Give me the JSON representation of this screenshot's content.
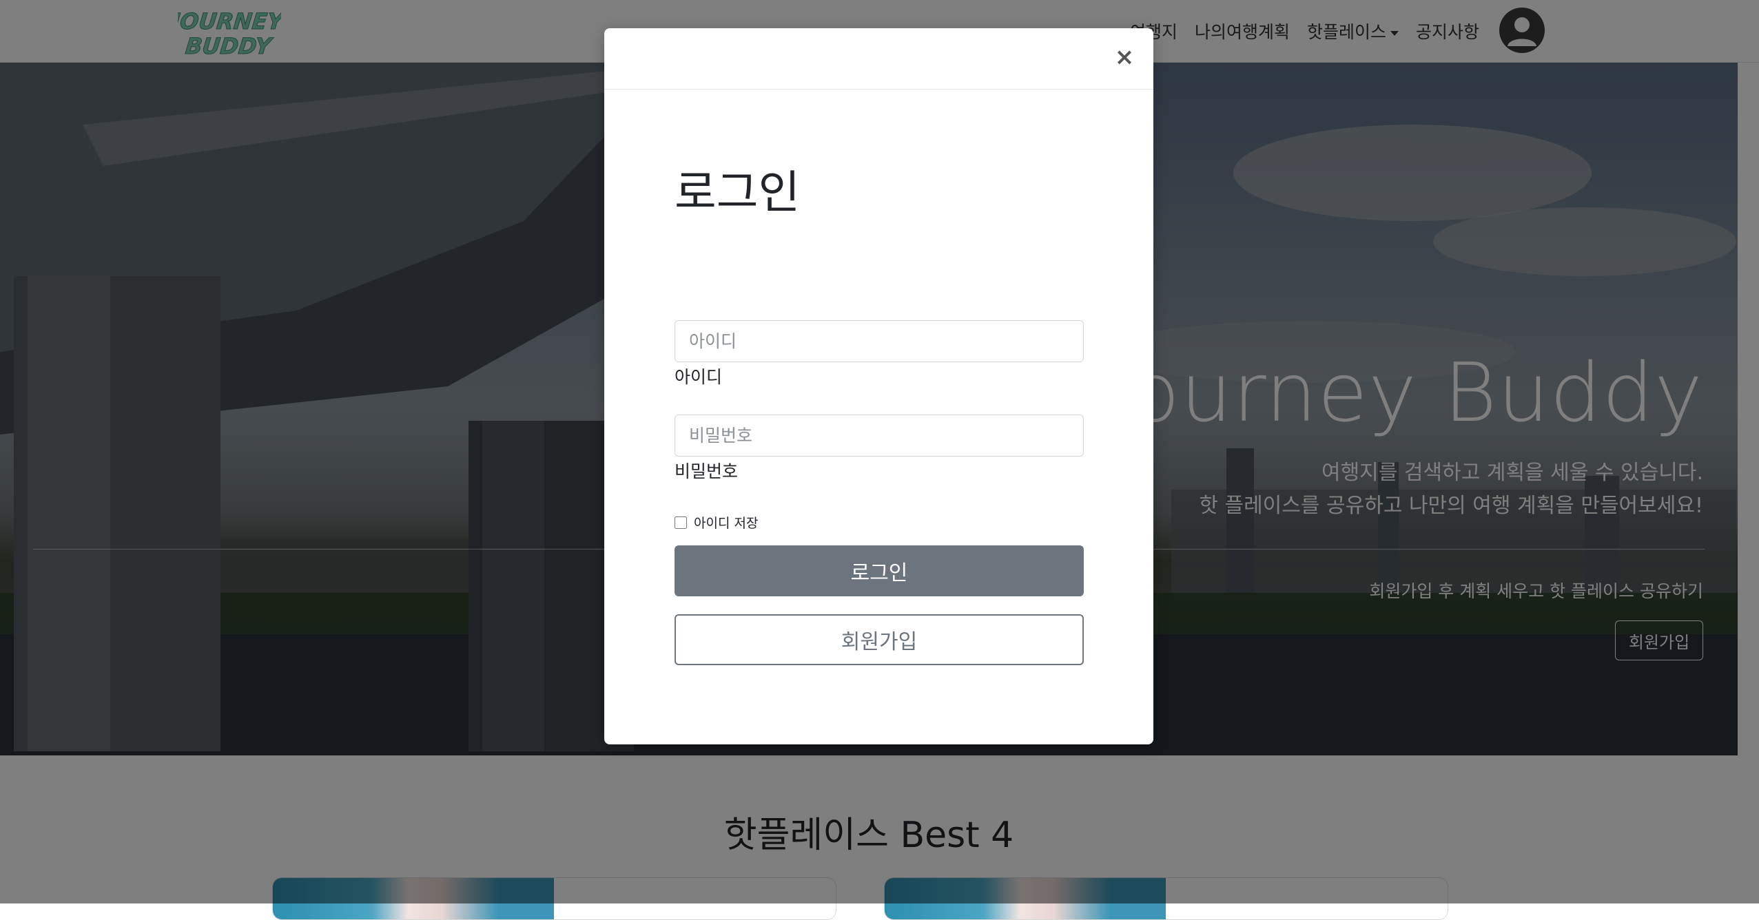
{
  "navbar": {
    "logo_text": [
      "JOURNEY",
      "BUDDY"
    ],
    "items": [
      {
        "label": "여행지"
      },
      {
        "label": "나의여행계획"
      },
      {
        "label": "핫플레이스"
      },
      {
        "label": "공지사항"
      }
    ]
  },
  "hero": {
    "title": "Journey Buddy",
    "subtitle_line1": "여행지를 검색하고 계획을 세울 수 있습니다.",
    "subtitle_line2": "핫 플레이스를 공유하고 나만의 여행 계획을 만들어보세요!",
    "cta_text": "회원가입 후 계획 세우고 핫 플레이스 공유하기",
    "signup_button": "회원가입"
  },
  "best": {
    "title": "핫플레이스 Best 4"
  },
  "login_modal": {
    "close_symbol": "×",
    "heading": "로그인",
    "id_placeholder": "아이디",
    "id_label": "아이디",
    "password_placeholder": "비밀번호",
    "password_label": "비밀번호",
    "remember_label": "아이디 저장",
    "login_button": "로그인",
    "signup_button": "회원가입"
  },
  "colors": {
    "login_button_bg": "#6c757d",
    "logo_green": "#7fd1b0",
    "backdrop": "rgba(0,0,0,0.5)"
  }
}
